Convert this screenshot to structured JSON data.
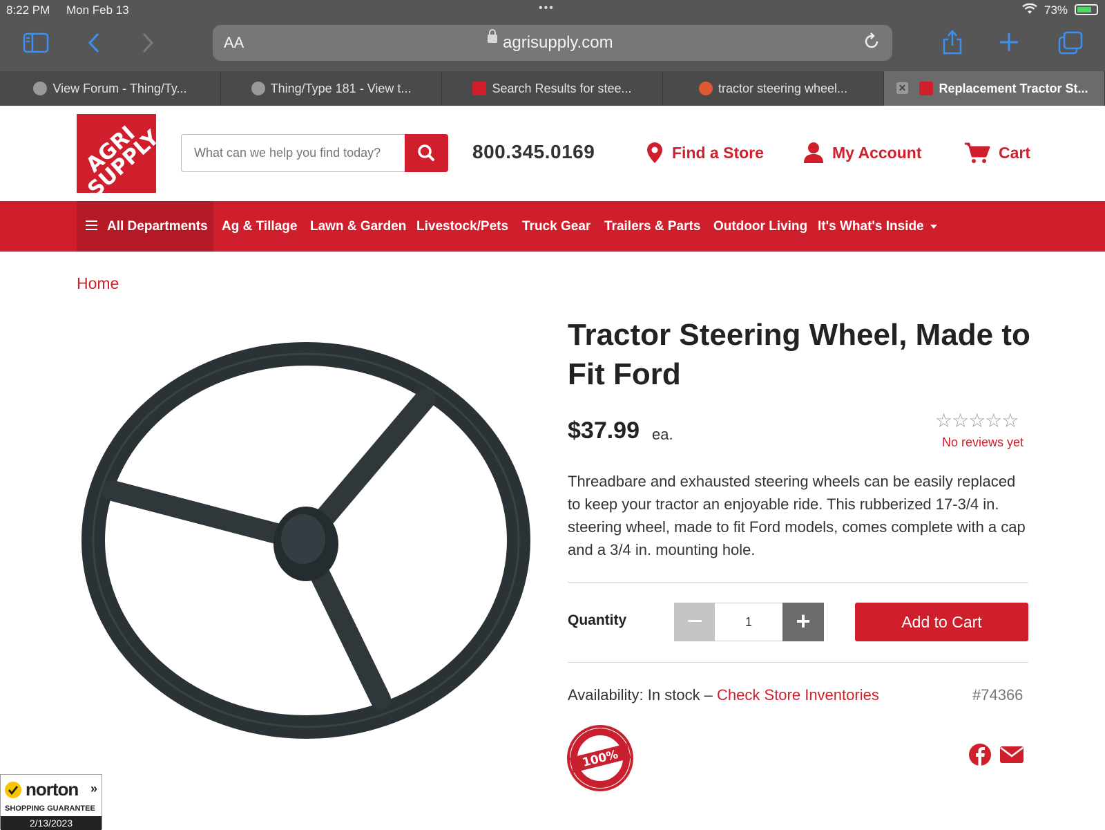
{
  "status_bar": {
    "time": "8:22 PM",
    "date": "Mon Feb 13",
    "battery": "73%"
  },
  "browser": {
    "url_aa": "AA",
    "url": "agrisupply.com",
    "tabs": [
      {
        "label": "View Forum - Thing/Ty..."
      },
      {
        "label": "Thing/Type 181 - View t..."
      },
      {
        "label": "Search Results for stee..."
      },
      {
        "label": "tractor steering wheel..."
      },
      {
        "label": "Replacement Tractor St..."
      }
    ]
  },
  "header": {
    "logo_text": "AGRI SUPPLY",
    "search_placeholder": "What can we help you find today?",
    "phone": "800.345.0169",
    "find_store": "Find a Store",
    "my_account": "My Account",
    "cart": "Cart"
  },
  "nav": {
    "all_departments": "All Departments",
    "items": [
      "Ag & Tillage",
      "Lawn & Garden",
      "Livestock/Pets",
      "Truck Gear",
      "Trailers & Parts",
      "Outdoor Living",
      "It's What's Inside"
    ]
  },
  "breadcrumb": "Home",
  "product": {
    "title": "Tractor Steering Wheel, Made to Fit Ford",
    "price": "$37.99",
    "unit": "ea.",
    "reviews": "No reviews yet",
    "rating_stars": 0,
    "description": "Threadbare and exhausted steering wheels can be easily replaced to keep your tractor an enjoyable ride. This rubberized 17-3/4 in. steering wheel, made to fit Ford models, comes complete with a cap and a 3/4 in. mounting hole.",
    "quantity_label": "Quantity",
    "quantity": "1",
    "add_to_cart": "Add to Cart",
    "availability": "Availability: In stock –",
    "check_inventory": "Check Store Inventories",
    "sku": "#74366"
  },
  "badge_text": "100%",
  "norton": {
    "brand": "norton",
    "tagline": "SHOPPING GUARANTEE",
    "date": "2/13/2023"
  },
  "colors": {
    "brand_red": "#d01f2c",
    "chrome_gray": "#565656",
    "safari_blue": "#3b8ff5"
  }
}
